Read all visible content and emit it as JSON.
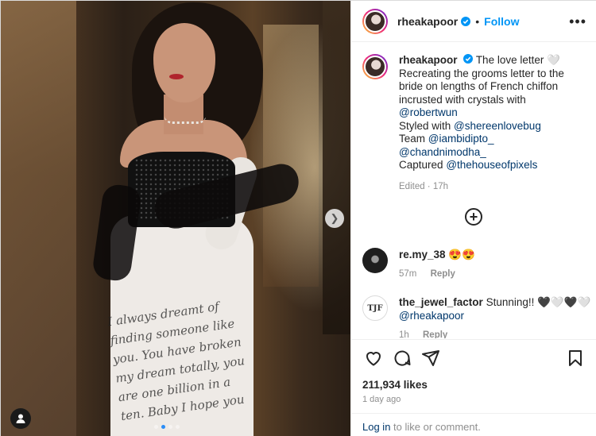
{
  "post": {
    "username": "rheakapoor",
    "follow_label": "Follow",
    "separator": "•",
    "more_label": "•••",
    "slide_count": 4,
    "active_slide": 2
  },
  "caption": {
    "username": "rheakapoor",
    "line1": "The love letter 🤍",
    "line2": "Recreating the grooms letter to the bride on lengths of French chiffon incrusted with crystals with",
    "mention1": "@robertwun",
    "styled_prefix": "Styled with",
    "mention2": "@shereenlovebug",
    "team_prefix": "Team",
    "mention3": "@iambidipto_",
    "mention4": "@chandnimodha_",
    "captured_prefix": "Captured",
    "mention5": "@thehouseofpixels",
    "meta": "Edited · 17h"
  },
  "comments": [
    {
      "username": "re.my_38",
      "text": "😍😍",
      "age": "57m",
      "reply_label": "Reply"
    },
    {
      "username": "the_jewel_factor",
      "text": "Stunning!! 🖤🤍🖤🤍",
      "mention": "@rheakapoor",
      "age": "1h",
      "reply_label": "Reply",
      "avatar_text": "TJF"
    }
  ],
  "likes": "211,934 likes",
  "posted": "1 day ago",
  "login": {
    "link": "Log in",
    "rest": " to like or comment."
  },
  "media": {
    "script_text": "I always dreamt of finding someone like you. You have broken my dream totally, you are one billion in a ten. Baby I hope you"
  },
  "icons": {
    "verified": "verified-badge-icon",
    "like": "heart-icon",
    "comment": "comment-bubble-icon",
    "share": "paper-plane-icon",
    "save": "bookmark-icon",
    "load_more": "plus-circle-icon",
    "next": "chevron-right-icon",
    "tag": "user-tag-icon"
  },
  "colors": {
    "accent": "#0095f6",
    "link": "#00376b",
    "muted": "#8e8e8e",
    "text": "#262626"
  }
}
